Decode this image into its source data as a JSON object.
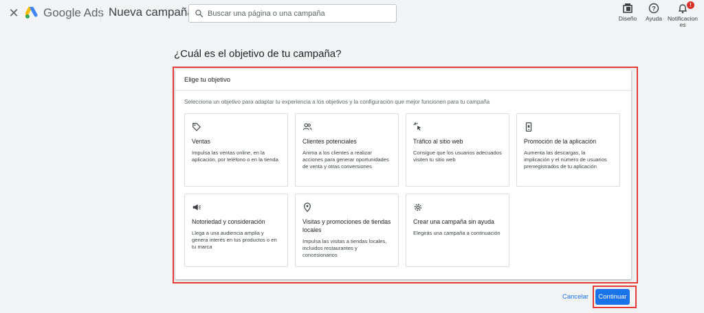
{
  "topbar": {
    "close_icon": "close-icon",
    "product_name": "Google Ads",
    "page_name": "Nueva campaña",
    "search": {
      "placeholder": "Buscar una página o una campaña",
      "value": ""
    },
    "tools": [
      {
        "label": "Diseño",
        "icon": "layout-icon"
      },
      {
        "label": "Ayuda",
        "icon": "help-icon"
      },
      {
        "label": "Notificaciones",
        "icon": "bell-icon",
        "badge": "!"
      }
    ]
  },
  "main": {
    "heading": "¿Cuál es el objetivo de tu campaña?",
    "card": {
      "header": "Elige tu objetivo",
      "description": "Selecciona un objetivo para adaptar tu experiencia a los objetivos y la configuración que mejor funcionen para tu campaña",
      "objectives": [
        {
          "icon": "tag-icon",
          "title": "Ventas",
          "description": "Impulsa las ventas online, en la aplicación, por teléfono o en la tienda"
        },
        {
          "icon": "people-icon",
          "title": "Clientes potenciales",
          "description": "Anima a los clientes a realizar acciones para generar oportunidades de venta y otras conversiones"
        },
        {
          "icon": "cursor-click-icon",
          "title": "Tráfico al sitio web",
          "description": "Consigue que los usuarios adecuados visiten tu sitio web"
        },
        {
          "icon": "phone-icon",
          "title": "Promoción de la aplicación",
          "description": "Aumenta las descargas, la implicación y el número de usuarios prerregistrados de tu aplicación"
        },
        {
          "icon": "megaphone-icon",
          "title": "Notoriedad y consideración",
          "description": "Llega a una audiencia amplia y genera interés en tus productos o en tu marca"
        },
        {
          "icon": "location-pin-icon",
          "title": "Visitas y promociones de tiendas locales",
          "description": "Impulsa las visitas a tiendas locales, incluidos restaurantes y concesionarios"
        },
        {
          "icon": "gear-icon",
          "title": "Crear una campaña sin ayuda",
          "description": "Elegirás una campaña a continuación"
        }
      ]
    }
  },
  "actions": {
    "cancel": "Cancelar",
    "continue": "Continuar"
  },
  "colors": {
    "accent": "#1a73e8",
    "annotation": "#e53935",
    "background": "#f1f3f4"
  }
}
